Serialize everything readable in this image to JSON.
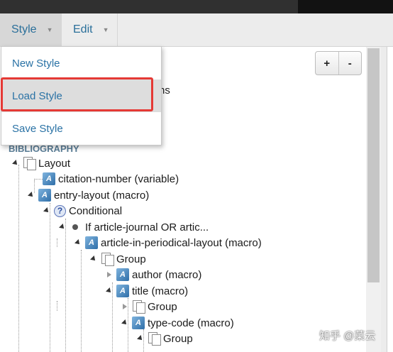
{
  "menubar": {
    "style_label": "Style",
    "edit_label": "Edit"
  },
  "dropdown": {
    "items": [
      {
        "label": "New Style"
      },
      {
        "label": "Load Style"
      },
      {
        "label": "Save Style"
      }
    ]
  },
  "toolbar": {
    "zoom_in": "+",
    "zoom_out": "-"
  },
  "partial_text": "ns",
  "tree": {
    "section": "BIBLIOGRAPHY",
    "nodes": [
      {
        "label": "Layout"
      },
      {
        "label": "citation-number (variable)"
      },
      {
        "label": "entry-layout (macro)"
      },
      {
        "label": "Conditional"
      },
      {
        "label": "If article-journal OR artic..."
      },
      {
        "label": "article-in-periodical-layout (macro)"
      },
      {
        "label": "Group"
      },
      {
        "label": "author (macro)"
      },
      {
        "label": "title (macro)"
      },
      {
        "label": "Group"
      },
      {
        "label": "type-code (macro)"
      },
      {
        "label": "Group"
      }
    ]
  },
  "watermark": "知乎 @菜云",
  "colors": {
    "link": "#2a72a5",
    "highlight": "#e53935"
  }
}
